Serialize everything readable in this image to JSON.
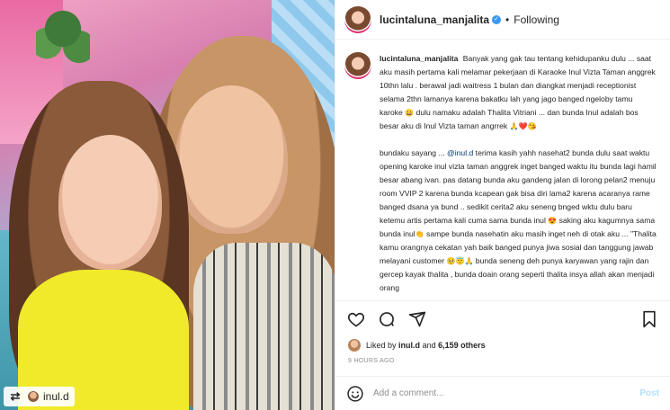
{
  "post": {
    "username": "lucintaluna_manjalita",
    "follow_status": "Following",
    "separator": "•",
    "repost": {
      "user": "inul.d"
    },
    "caption_paragraphs": [
      [
        {
          "t": "Banyak yang gak tau tentang kehidupanku dulu ... saat aku masih pertama kali melamar pekerjaan di Karaoke Inul Vizta Taman anggrek 10thn lalu . berawal jadi waitress 1 bulan dan diangkat menjadi receptionist selama 2thn lamanya karena bakatku lah yang jago banged ngeloby tamu karoke "
        },
        {
          "e": "😀"
        },
        {
          "t": " dulu namaku adalah Thalita Vitriani ... dan bunda Inul adalah bos besar aku di Inul Vizta taman angrrek "
        },
        {
          "e": "🙏❤️😘"
        }
      ],
      [
        {
          "t": "bundaku sayang ... "
        },
        {
          "m": "@inul.d"
        },
        {
          "t": " terima kasih yahh nasehat2 bunda dulu saat waktu opening karoke inul vizta taman anggrek inget banged waktu itu bunda lagi hamil besar abang ivan. pas datang bunda aku gandeng jalan di lorong pelan2 menuju room VVIP 2 karena bunda kcapean gak bisa diri lama2 karena acaranya rame banged dsana ya bund .. sedikit cerita2 aku seneng bnged wktu dulu baru ketemu artis pertama kali cuma sama bunda inul "
        },
        {
          "e": "😍"
        },
        {
          "t": " saking aku kagumnya sama bunda inul"
        },
        {
          "e": "👏"
        },
        {
          "t": " sampe bunda nasehatin aku masih inget neh di otak aku ... \"Thalita kamu orangnya cekatan yah baik banged punya jiwa sosial dan tanggung jawab melayani customer "
        },
        {
          "e": "🥺😇🙏"
        },
        {
          "t": " bunda seneng deh punya karyawan yang rajin dan gercep kayak thalita , bunda doain orang seperti thalita insya allah akan menjadi orang"
        }
      ]
    ],
    "likes": {
      "prefix": "Liked by",
      "user": "inul.d",
      "connector": "and",
      "others": "6,159 others"
    },
    "timestamp": "9 HOURS AGO",
    "comment": {
      "placeholder": "Add a comment...",
      "post_label": "Post"
    },
    "colors": {
      "link": "#00376b",
      "verified": "#3897f0",
      "post_button": "#b2dffc",
      "muted": "#8e8e8e"
    },
    "icons": [
      "heart-icon",
      "comment-icon",
      "share-icon",
      "bookmark-icon",
      "emoji-icon",
      "verified-badge-icon",
      "repost-icon"
    ]
  }
}
